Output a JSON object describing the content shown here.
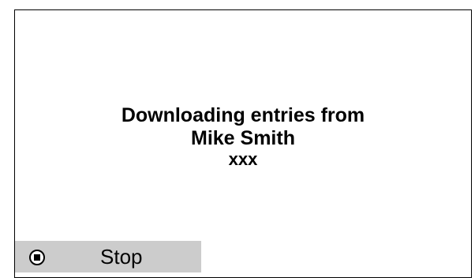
{
  "dialog": {
    "message_line1": "Downloading entries from",
    "message_line2": "Mike Smith",
    "message_line3": "xxx"
  },
  "softkey": {
    "label": "Stop",
    "icon": "stop-icon",
    "background_color": "#cccccc"
  }
}
